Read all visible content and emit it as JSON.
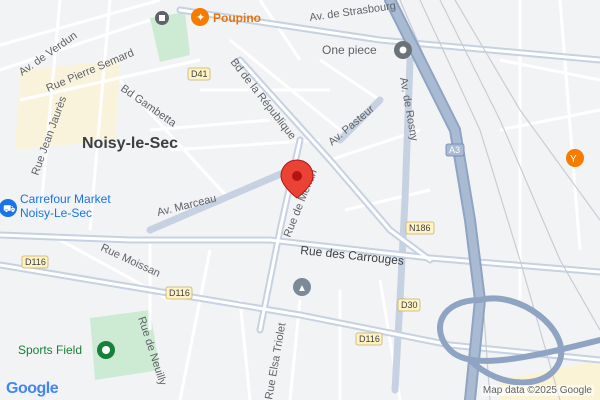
{
  "map": {
    "labels": {
      "strasbourg": "Av. de Strasbourg",
      "verdun": "Av. de Verdun",
      "semard": "Rue Pierre Semard",
      "gambetta": "Bd Gambetta",
      "jaures": "Rue Jean Jaurès",
      "republique": "Bd de la République",
      "pasteur": "Av. Pasteur",
      "rosny": "Av. de Rosny",
      "marceau": "Av. Marceau",
      "merlan": "Rue de Merlan",
      "carrouges": "Rue des Carrouges",
      "moissan": "Rue Moissan",
      "neuilly": "Rue de Neuilly",
      "triolet": "Rue Elsa Triolet",
      "city": "Noisy-le-Sec"
    },
    "route_shields": {
      "d41": "D41",
      "a3": "A3",
      "n186": "N186",
      "d116a": "D116",
      "d116b": "D116",
      "d116c": "D116",
      "d30": "D30"
    },
    "pois": {
      "poupino": "Poupino",
      "one_piece": "One piece",
      "carrefour_line1": "Carrefour Market",
      "carrefour_line2": "Noisy-Le-Sec",
      "sports_field": "Sports Field"
    },
    "attribution": "Map data ©2025 Google",
    "logo": "Google",
    "colors": {
      "background": "#f2f3f5",
      "major_road": "#c6d2e2",
      "highway": "#8fa4c2",
      "marker": "#ea4335",
      "park": "#cdebd3",
      "food_poi": "#f57c00",
      "place_poi": "#5f6368"
    }
  }
}
